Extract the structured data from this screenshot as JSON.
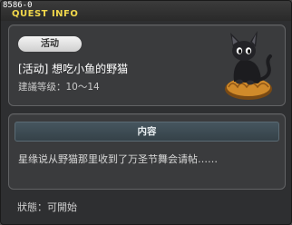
{
  "window": {
    "id_label": "8586-0",
    "title": "QUEST INFO"
  },
  "quest": {
    "category": "活动",
    "name": "[活动] 想吃小鱼的野猫",
    "level_label": "建議等级：",
    "level_value": "10～14",
    "illustration": "black-cat-on-pumpkin-icon"
  },
  "content": {
    "header": "内容",
    "text": "星缘说从野猫那里收到了万圣节舞会请帖……"
  },
  "status": {
    "label": "狀態：",
    "value": "可開始"
  },
  "colors": {
    "title_accent": "#f2d84b",
    "panel_bg": "#3a3b3d",
    "window_bg": "#2e2f31",
    "header_bar": "#3f4d55"
  }
}
